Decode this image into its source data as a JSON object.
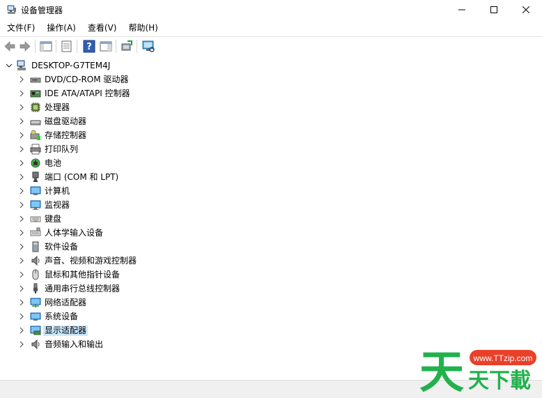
{
  "window": {
    "title": "设备管理器"
  },
  "menu": [
    "文件(F)",
    "操作(A)",
    "查看(V)",
    "帮助(H)"
  ],
  "toolbar": {
    "buttons": [
      "back-arrow-icon",
      "forward-arrow-icon",
      "show-hide-tree-icon",
      "properties-icon",
      "help-icon",
      "action-pane-icon",
      "update-driver-icon",
      "scan-hardware-icon"
    ]
  },
  "tree": {
    "root": "DESKTOP-G7TEM4J",
    "items": [
      {
        "label": "DVD/CD-ROM 驱动器",
        "icon": "dvd-drive-icon"
      },
      {
        "label": "IDE ATA/ATAPI 控制器",
        "icon": "ide-controller-icon"
      },
      {
        "label": "处理器",
        "icon": "processor-icon"
      },
      {
        "label": "磁盘驱动器",
        "icon": "disk-drive-icon"
      },
      {
        "label": "存储控制器",
        "icon": "storage-controller-icon"
      },
      {
        "label": "打印队列",
        "icon": "printer-icon"
      },
      {
        "label": "电池",
        "icon": "battery-icon"
      },
      {
        "label": "端口 (COM 和 LPT)",
        "icon": "port-icon"
      },
      {
        "label": "计算机",
        "icon": "computer-icon"
      },
      {
        "label": "监视器",
        "icon": "monitor-icon"
      },
      {
        "label": "键盘",
        "icon": "keyboard-icon"
      },
      {
        "label": "人体学输入设备",
        "icon": "hid-icon"
      },
      {
        "label": "软件设备",
        "icon": "software-device-icon"
      },
      {
        "label": "声音、视频和游戏控制器",
        "icon": "speaker-icon"
      },
      {
        "label": "鼠标和其他指针设备",
        "icon": "mouse-icon"
      },
      {
        "label": "通用串行总线控制器",
        "icon": "usb-icon"
      },
      {
        "label": "网络适配器",
        "icon": "network-adapter-icon"
      },
      {
        "label": "系统设备",
        "icon": "system-device-icon"
      },
      {
        "label": "显示适配器",
        "icon": "display-adapter-icon",
        "selected": true
      },
      {
        "label": "音频输入和输出",
        "icon": "audio-io-icon"
      }
    ]
  },
  "watermark": {
    "url": "www.TTzip.com",
    "text": "天下載",
    "logo": "天"
  },
  "colors": {
    "accent_green": "#22b14c",
    "selection": "#cce8ff",
    "watermark_red": "#e8402a"
  }
}
